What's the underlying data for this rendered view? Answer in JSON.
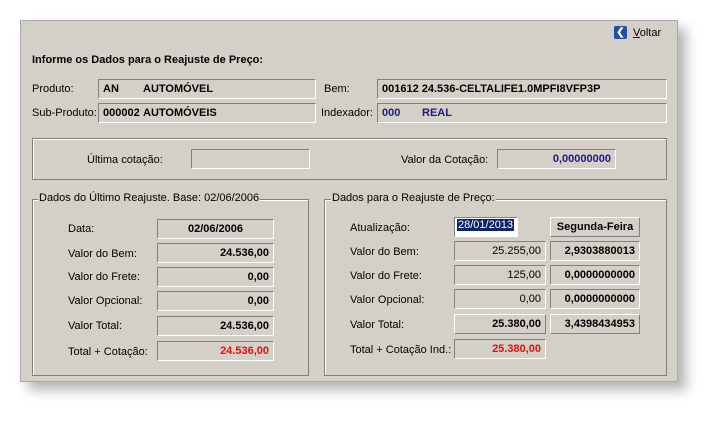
{
  "header": {
    "voltar_label": "Voltar",
    "title": "Informe os Dados para o Reajuste de Preço:"
  },
  "produto": {
    "label": "Produto:",
    "code": "AN",
    "name": "AUTOMÓVEL"
  },
  "sub_produto": {
    "label": "Sub-Produto:",
    "code": "000002",
    "name": "AUTOMÓVEIS"
  },
  "bem": {
    "label": "Bem:",
    "value": "001612 24.536-CELTALIFE1.0MPFI8VFP3P"
  },
  "indexador": {
    "label": "Indexador:",
    "code": "000",
    "name": "REAL"
  },
  "cotacao": {
    "ultima_label": "Última cotação:",
    "ultima_value": "",
    "valor_label": "Valor da Cotação:",
    "valor_value": "0,00000000"
  },
  "ultimo_reajuste": {
    "legend": "Dados do Último Reajuste. Base: 02/06/2006",
    "data_label": "Data:",
    "data_value": "02/06/2006",
    "bem_label": "Valor do Bem:",
    "bem_value": "24.536,00",
    "frete_label": "Valor do Frete:",
    "frete_value": "0,00",
    "opcional_label": "Valor Opcional:",
    "opcional_value": "0,00",
    "total_label": "Valor Total:",
    "total_value": "24.536,00",
    "total_cot_label": "Total + Cotação:",
    "total_cot_value": "24.536,00"
  },
  "reajuste": {
    "legend": "Dados para o Reajuste de Preço:",
    "atualizacao_label": "Atualização:",
    "atualizacao_value": "28/01/2013",
    "dia_semana": "Segunda-Feira",
    "bem_label": "Valor do Bem:",
    "bem_value": "25.255,00",
    "bem_indice": "2,9303880013",
    "frete_label": "Valor do Frete:",
    "frete_value": "125,00",
    "frete_indice": "0,0000000000",
    "opcional_label": "Valor Opcional:",
    "opcional_value": "0,00",
    "opcional_indice": "0,0000000000",
    "total_label": "Valor Total:",
    "total_value": "25.380,00",
    "total_indice": "3,4398434953",
    "total_cot_label": "Total + Cotação Ind.:",
    "total_cot_value": "25.380,00"
  },
  "colors": {
    "red_value": "#e01010",
    "navy_value": "#1a1a8c",
    "window_bg": "#d4d0c8"
  }
}
